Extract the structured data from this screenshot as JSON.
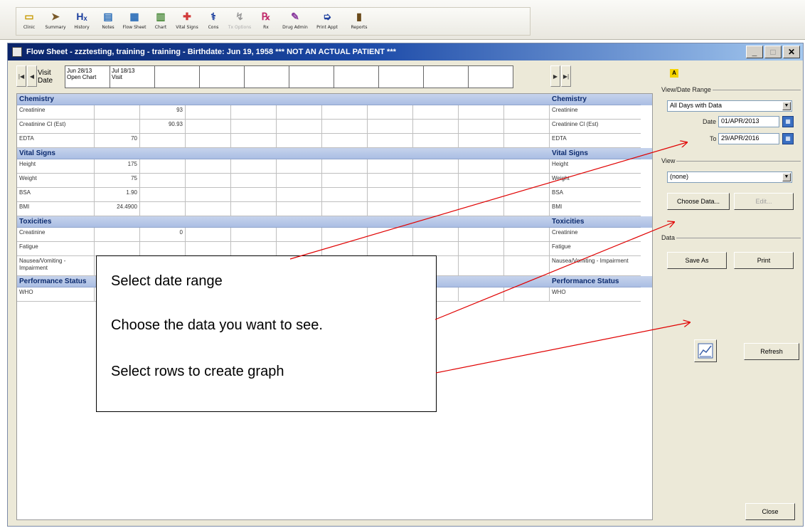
{
  "toolbar": {
    "items": [
      {
        "label": "Clinic",
        "icon": "clinic-icon",
        "glyph": "▭",
        "color": "#c79a00"
      },
      {
        "label": "Summary",
        "icon": "summary-icon",
        "glyph": "➤",
        "color": "#7a5a2a"
      },
      {
        "label": "History",
        "icon": "history-icon",
        "glyph": "Hₓ",
        "color": "#1c3f9e"
      },
      {
        "label": "Notes",
        "icon": "notes-icon",
        "glyph": "▤",
        "color": "#2a6db8"
      },
      {
        "label": "Flow Sheet",
        "icon": "flow-sheet-icon",
        "glyph": "▦",
        "color": "#2a6db8"
      },
      {
        "label": "Chart",
        "icon": "chart-icon",
        "glyph": "▥",
        "color": "#4a8a3a"
      },
      {
        "label": "Vital Signs",
        "icon": "vital-signs-icon",
        "glyph": "✚",
        "color": "#d23a3a"
      },
      {
        "label": "Cons",
        "icon": "consult-icon",
        "glyph": "⚕",
        "color": "#1c3f9e"
      },
      {
        "label": "Tx Options",
        "icon": "tx-options-icon",
        "glyph": "↯",
        "color": "#999999",
        "disabled": true
      },
      {
        "label": "Rx",
        "icon": "rx-icon",
        "glyph": "℞",
        "color": "#c02a6a"
      },
      {
        "label": "Drug Admin",
        "icon": "drug-admin-icon",
        "glyph": "✎",
        "color": "#8a3a9e"
      },
      {
        "label": "Print Appt",
        "icon": "print-appt-icon",
        "glyph": "➭",
        "color": "#1c3f9e"
      },
      {
        "label": "Reports",
        "icon": "reports-icon",
        "glyph": "▮",
        "color": "#6a4a1a"
      }
    ]
  },
  "window": {
    "title": "Flow Sheet  -  zzztesting, training  - training  - Birthdate: Jun 19, 1958 *** NOT AN ACTUAL PATIENT ***",
    "minimize": "_",
    "maximize": "□",
    "close": "✕"
  },
  "visit_bar": {
    "first": "|◀",
    "prev": "◀",
    "label": "Visit Date",
    "next": "▶",
    "last": "▶|",
    "cells": [
      {
        "line1": "Jun 28/13",
        "line2": "Open Chart"
      },
      {
        "line1": "Jul 18/13",
        "line2": "Visit"
      },
      {
        "line1": "",
        "line2": ""
      },
      {
        "line1": "",
        "line2": ""
      },
      {
        "line1": "",
        "line2": ""
      },
      {
        "line1": "",
        "line2": ""
      },
      {
        "line1": "",
        "line2": ""
      },
      {
        "line1": "",
        "line2": ""
      },
      {
        "line1": "",
        "line2": ""
      },
      {
        "line1": "",
        "line2": ""
      }
    ]
  },
  "grid": {
    "rows": [
      {
        "type": "section",
        "label": "Chemistry"
      },
      {
        "type": "data",
        "label": "Creatinine",
        "values": [
          "",
          "93",
          "",
          "",
          "",
          "",
          "",
          "",
          "",
          ""
        ]
      },
      {
        "type": "data",
        "label": "Creatinine Cl (Est)",
        "values": [
          "",
          "90.93",
          "",
          "",
          "",
          "",
          "",
          "",
          "",
          ""
        ]
      },
      {
        "type": "data",
        "label": "EDTA",
        "values": [
          "70",
          "",
          "",
          "",
          "",
          "",
          "",
          "",
          "",
          ""
        ]
      },
      {
        "type": "section",
        "label": "Vital Signs"
      },
      {
        "type": "data",
        "label": "Height",
        "values": [
          "175",
          "",
          "",
          "",
          "",
          "",
          "",
          "",
          "",
          ""
        ]
      },
      {
        "type": "data",
        "label": "Weight",
        "values": [
          "75",
          "",
          "",
          "",
          "",
          "",
          "",
          "",
          "",
          ""
        ]
      },
      {
        "type": "data",
        "label": "BSA",
        "values": [
          "1.90",
          "",
          "",
          "",
          "",
          "",
          "",
          "",
          "",
          ""
        ]
      },
      {
        "type": "data",
        "label": "BMI",
        "values": [
          "24.4900",
          "",
          "",
          "",
          "",
          "",
          "",
          "",
          "",
          ""
        ]
      },
      {
        "type": "section",
        "label": "Toxicities"
      },
      {
        "type": "data",
        "label": "Creatinine",
        "values": [
          "",
          "0",
          "",
          "",
          "",
          "",
          "",
          "",
          "",
          ""
        ]
      },
      {
        "type": "data",
        "label": "Fatigue",
        "values": [
          "",
          "",
          "",
          "",
          "",
          "",
          "",
          "",
          "",
          ""
        ]
      },
      {
        "type": "data",
        "label": "Nausea/Vomiting - Impairment",
        "values": [
          "",
          "",
          "",
          "",
          "",
          "",
          "",
          "",
          "",
          ""
        ],
        "tall": true
      },
      {
        "type": "section",
        "label": "Performance Status"
      },
      {
        "type": "data",
        "label": "WHO",
        "values": [
          "",
          "",
          "",
          "",
          "",
          "",
          "",
          "",
          "",
          ""
        ]
      }
    ]
  },
  "panel": {
    "alert": "A",
    "range_legend": "View/Date Range",
    "range_select": "All Days with Data",
    "date_label": "Date",
    "date_value": "01/APR/2013",
    "to_label": "To",
    "to_value": "29/APR/2016",
    "view_legend": "View",
    "view_select": "(none)",
    "choose_data": "Choose Data...",
    "edit": "Edit...",
    "data_legend": "Data",
    "save_as": "Save As",
    "print": "Print",
    "refresh": "Refresh",
    "close": "Close"
  },
  "callout": {
    "line1": "Select date range",
    "line2": "Choose the data you want to see.",
    "line3": "Select rows to create graph"
  },
  "colors": {
    "title_bar": "#0a246a",
    "section_header": "#b9c9e8",
    "arrow": "#e00000"
  }
}
